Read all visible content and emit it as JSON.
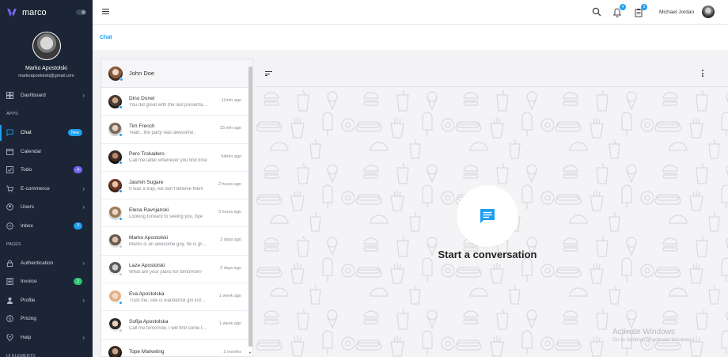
{
  "brand": {
    "name": "marco"
  },
  "profile": {
    "name": "Marko Apostolski",
    "email": "markoapostolski@gmail.com"
  },
  "sidebar": {
    "dashboard": "Dashboard",
    "section_apps": "APPS",
    "chat": "Chat",
    "chat_badge": "New",
    "calendar": "Calendar",
    "todo": "Todo",
    "todo_badge": "4",
    "ecommerce": "E-commerce",
    "users": "Users",
    "inbox": "Inbox",
    "inbox_badge": "3",
    "section_pages": "PAGES",
    "authentication": "Authentication",
    "invoice": "Invoice",
    "invoice_badge": "2",
    "profile": "Profile",
    "pricing": "Pricing",
    "help": "Help",
    "section_ui": "UI ELEMENTS"
  },
  "topbar": {
    "notifications_count": "4",
    "tasks_count": "3",
    "user_name": "Michael Jordan"
  },
  "breadcrumb": {
    "current": "Chat"
  },
  "chat_list": {
    "header_name": "John Doe",
    "items": [
      {
        "name": "Dino Donel",
        "message": "You did great with the last presentation",
        "time": "11min ago"
      },
      {
        "name": "Tim French",
        "message": "Yeah.. the party was awesome.",
        "time": "33 min ago"
      },
      {
        "name": "Pero Trokadero",
        "message": "Call me latter whenever you find time",
        "time": "54min ago"
      },
      {
        "name": "Jasmin Sugare",
        "message": "It was a trap, we don't believe them",
        "time": "2 hours ago"
      },
      {
        "name": "Elena Ravnjanski",
        "message": "Looking forward to seeing you, bye",
        "time": "3 hours ago"
      },
      {
        "name": "Marko Apostolski",
        "message": "Marko is an awesome guy, he is great",
        "time": "2 days ago"
      },
      {
        "name": "Laze Apostolski",
        "message": "What are your plans for tomorrow?",
        "time": "2 days ago"
      },
      {
        "name": "Eva Apostolska",
        "message": "Trust me, she is wanderfull girl indeed",
        "time": "1 week ago"
      },
      {
        "name": "Sofija Apostolska",
        "message": "Call me tomorrow, I will find some time",
        "time": "1 week ago"
      },
      {
        "name": "Tope Marketing",
        "message": "",
        "time": "2 months"
      }
    ]
  },
  "chat_area": {
    "empty_title": "Start a conversation"
  },
  "watermark": {
    "title": "Activate Windows",
    "subtitle": "Go to Settings to activate Windows."
  },
  "colors": {
    "sidebar": "#1b2535",
    "accent": "#1e9ff2",
    "badge_purple": "#7367f0",
    "badge_green": "#28c76f"
  }
}
